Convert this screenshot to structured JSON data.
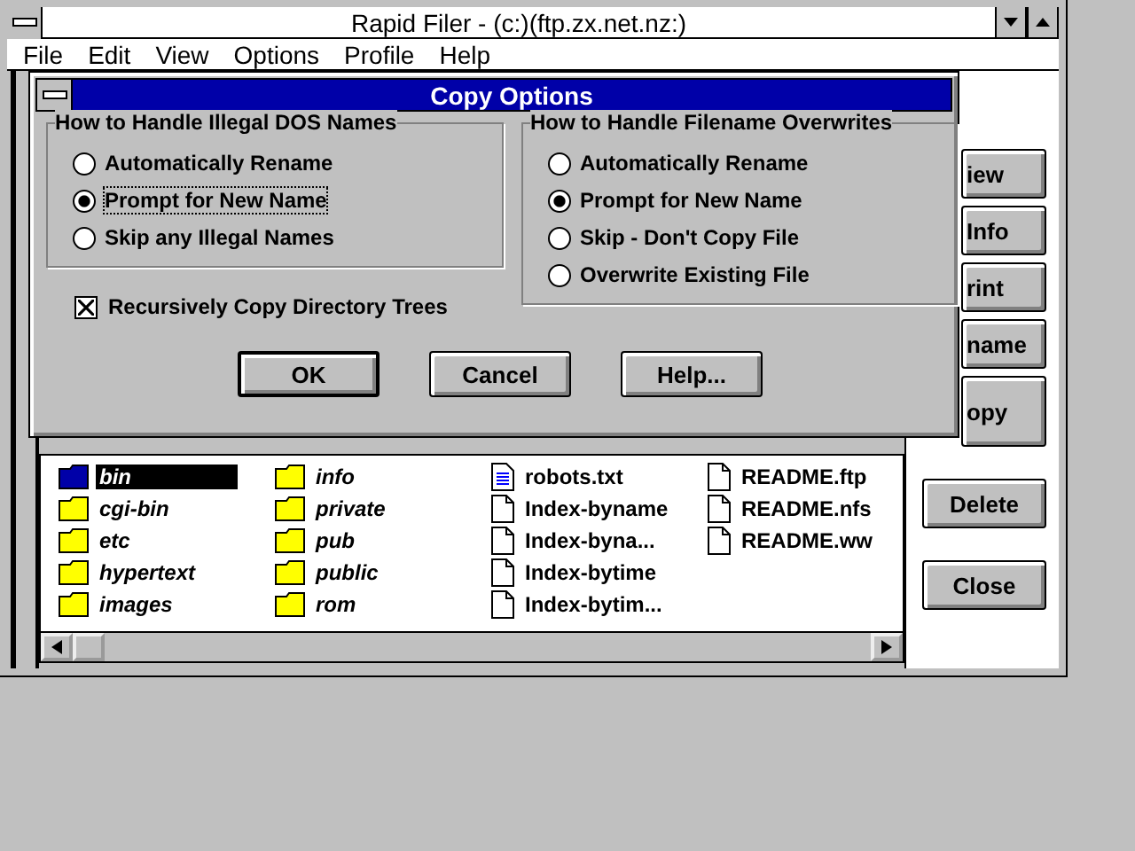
{
  "window": {
    "title": "Rapid Filer - (c:)(ftp.zx.net.nz:)"
  },
  "menu": [
    "File",
    "Edit",
    "View",
    "Options",
    "Profile",
    "Help"
  ],
  "side_buttons": [
    {
      "label": "iew",
      "tall": false
    },
    {
      "label": "Info",
      "tall": false
    },
    {
      "label": "rint",
      "tall": false
    },
    {
      "label": "name",
      "tall": false
    },
    {
      "label": "opy",
      "tall": true
    }
  ],
  "buttons": [
    "Delete",
    "Close"
  ],
  "files": [
    [
      {
        "name": "bin",
        "kind": "folder",
        "selected": true
      },
      {
        "name": "cgi-bin",
        "kind": "folder",
        "selected": false
      },
      {
        "name": "etc",
        "kind": "folder",
        "selected": false
      },
      {
        "name": "hypertext",
        "kind": "folder",
        "selected": false
      },
      {
        "name": "images",
        "kind": "folder",
        "selected": false
      }
    ],
    [
      {
        "name": "info",
        "kind": "folder",
        "selected": false
      },
      {
        "name": "private",
        "kind": "folder",
        "selected": false
      },
      {
        "name": "pub",
        "kind": "folder",
        "selected": false
      },
      {
        "name": "public",
        "kind": "folder",
        "selected": false
      },
      {
        "name": "rom",
        "kind": "folder",
        "selected": false
      }
    ],
    [
      {
        "name": "robots.txt",
        "kind": "text",
        "selected": false
      },
      {
        "name": "Index-byname",
        "kind": "file",
        "selected": false
      },
      {
        "name": "Index-byna...",
        "kind": "file",
        "selected": false
      },
      {
        "name": "Index-bytime",
        "kind": "file",
        "selected": false
      },
      {
        "name": "Index-bytim...",
        "kind": "file",
        "selected": false
      }
    ],
    [
      {
        "name": "README.ftp",
        "kind": "file",
        "selected": false
      },
      {
        "name": "README.nfs",
        "kind": "file",
        "selected": false
      },
      {
        "name": "README.ww",
        "kind": "file",
        "selected": false
      }
    ]
  ],
  "dialog": {
    "title": "Copy Options",
    "groups": [
      {
        "title": "How to Handle Illegal DOS Names",
        "options": [
          {
            "label": "Automatically Rename",
            "selected": false,
            "focused": false
          },
          {
            "label": "Prompt for New Name",
            "selected": true,
            "focused": true
          },
          {
            "label": "Skip any Illegal Names",
            "selected": false,
            "focused": false
          }
        ]
      },
      {
        "title": "How to Handle Filename Overwrites",
        "options": [
          {
            "label": "Automatically Rename",
            "selected": false,
            "focused": false
          },
          {
            "label": "Prompt for New Name",
            "selected": true,
            "focused": false
          },
          {
            "label": "Skip - Don't Copy File",
            "selected": false,
            "focused": false
          },
          {
            "label": "Overwrite Existing File",
            "selected": false,
            "focused": false
          }
        ]
      }
    ],
    "checkbox": {
      "label": "Recursively Copy Directory Trees",
      "checked": true
    },
    "buttons": [
      {
        "label": "OK",
        "default": true
      },
      {
        "label": "Cancel",
        "default": false
      },
      {
        "label": "Help...",
        "default": false
      }
    ]
  }
}
